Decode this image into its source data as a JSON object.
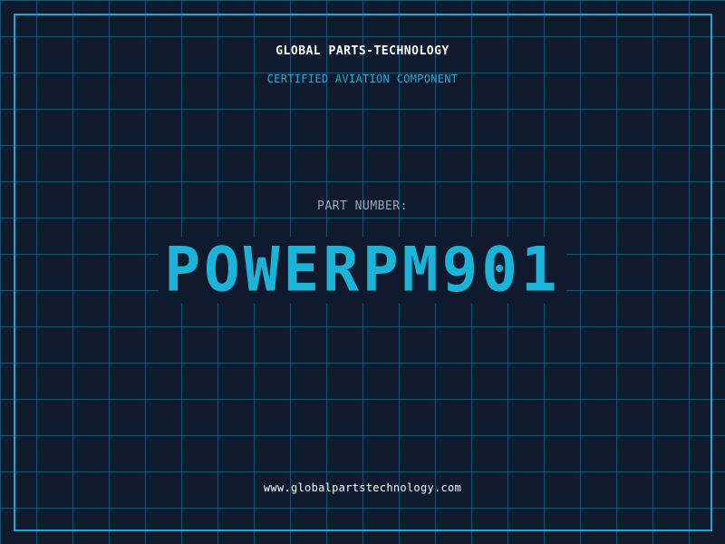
{
  "header": {
    "company": "GLOBAL PARTS-TECHNOLOGY",
    "subtitle": "CERTIFIED AVIATION COMPONENT"
  },
  "part": {
    "label": "PART NUMBER:",
    "number": "POWERPM901"
  },
  "footer": {
    "website": "www.globalpartstechnology.com"
  },
  "colors": {
    "background": "#0f1a2e",
    "grid": "#26809e",
    "accent": "#1ab4d8",
    "border": "#1ea8d0",
    "label": "#9aa8b6",
    "text": "#ffffff"
  }
}
